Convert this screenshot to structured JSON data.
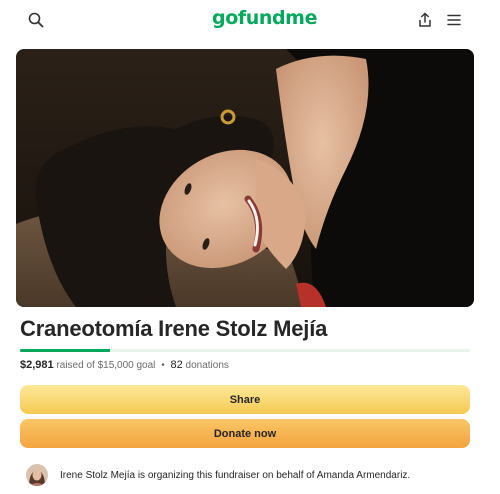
{
  "header": {
    "logo": "gofundme",
    "search_icon": "search-icon",
    "share_icon": "share-upload-icon",
    "menu_icon": "hamburger-menu-icon"
  },
  "campaign": {
    "title": "Craneotomía Irene Stolz Mejía",
    "raised": "$2,981",
    "raised_of_goal": "raised of $15,000 goal",
    "separator": "•",
    "donations_count": "82",
    "donations_label": "donations",
    "progress_fraction": 0.199
  },
  "actions": {
    "share_label": "Share",
    "donate_label": "Donate now"
  },
  "organizer": {
    "text": "Irene Stolz Mejía is organizing this fundraiser on behalf of Amanda Armendariz."
  },
  "colors": {
    "brand_green": "#02a95c",
    "share_button": "#f9d770",
    "donate_button": "#f5b14c"
  }
}
